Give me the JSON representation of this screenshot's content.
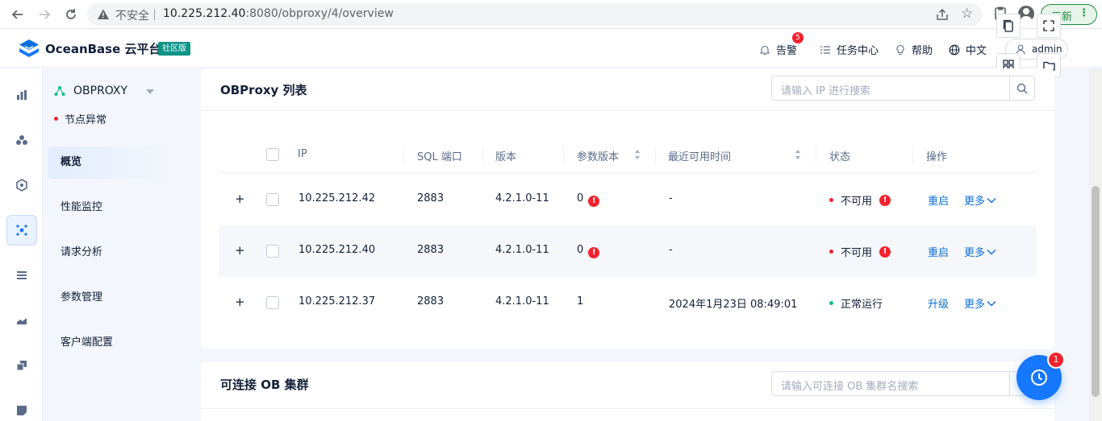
{
  "browser": {
    "insecure_label": "不安全",
    "url_host": "10.225.212.40",
    "url_rest": ":8080/obproxy/4/overview",
    "update_label": "三新"
  },
  "header": {
    "brand": "OceanBase 云平台",
    "edition": "社区版",
    "alerts_label": "告警",
    "alerts_count": "5",
    "tasks_label": "任务中心",
    "help_label": "帮助",
    "language_label": "中文",
    "user_name": "admin"
  },
  "sidebar": {
    "cluster_name": "OBPROXY",
    "node_status": "节点异常",
    "menu": [
      {
        "label": "概览",
        "active": true
      },
      {
        "label": "性能监控"
      },
      {
        "label": "请求分析"
      },
      {
        "label": "参数管理"
      },
      {
        "label": "客户端配置"
      }
    ]
  },
  "obproxy_list": {
    "title": "OBProxy 列表",
    "search_placeholder": "请输入 IP 进行搜索",
    "columns": [
      "IP",
      "SQL 端口",
      "版本",
      "参数版本",
      "最近可用时间",
      "状态",
      "操作"
    ],
    "rows": [
      {
        "ip": "10.225.212.42",
        "sql_port": "2883",
        "version": "4.2.1.0-11",
        "param_version": "0",
        "last_available": "-",
        "status": "不可用",
        "status_color": "#f5222d",
        "action": "重启",
        "more": "更多"
      },
      {
        "ip": "10.225.212.40",
        "sql_port": "2883",
        "version": "4.2.1.0-11",
        "param_version": "0",
        "last_available": "-",
        "status": "不可用",
        "status_color": "#f5222d",
        "action": "重启",
        "more": "更多"
      },
      {
        "ip": "10.225.212.37",
        "sql_port": "2883",
        "version": "4.2.1.0-11",
        "param_version": "1",
        "last_available": "2024年1月23日 08:49:01",
        "status": "正常运行",
        "status_color": "#0ac185",
        "action": "升级",
        "more": "更多"
      }
    ]
  },
  "ob_clusters": {
    "title": "可连接 OB 集群",
    "search_placeholder": "请输入可连接 OB 集群名搜索"
  },
  "fab": {
    "badge": "1"
  },
  "colors": {
    "primary": "#0a6fdc",
    "danger": "#f5222d",
    "success": "#0ac185",
    "brand": "#1677ff"
  }
}
